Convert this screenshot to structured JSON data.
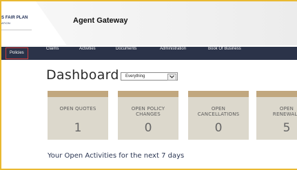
{
  "header": {
    "logo_line1": "S FAIR PLAN",
    "logo_line2": "ATION",
    "title": "Agent Gateway"
  },
  "nav": {
    "items": [
      {
        "label": "Policies",
        "active": true
      },
      {
        "label": "Claims",
        "active": false
      },
      {
        "label": "Activities",
        "active": false
      },
      {
        "label": "Documents",
        "active": false
      },
      {
        "label": "Administration",
        "active": false
      },
      {
        "label": "Book Of Business",
        "active": false
      }
    ]
  },
  "dashboard": {
    "title": "Dashboard",
    "filter": {
      "selected": "Everything",
      "icon": "chevron-down-icon"
    },
    "cards": [
      {
        "line1": "OPEN QUOTES",
        "line2": "",
        "count": "1"
      },
      {
        "line1": "OPEN POLICY",
        "line2": "CHANGES",
        "count": "0"
      },
      {
        "line1": "OPEN",
        "line2": "CANCELLATIONS",
        "count": "0"
      },
      {
        "line1": "OPEN",
        "line2": "RENEWALS",
        "count": "5"
      }
    ],
    "activities_heading": "Your Open Activities for the next 7 days"
  },
  "colors": {
    "outer_border": "#e9b931",
    "navbar": "#2b3349",
    "active_outline": "#d33a3a",
    "card_bg": "#dcd8cc",
    "card_top": "#c1a77e"
  }
}
